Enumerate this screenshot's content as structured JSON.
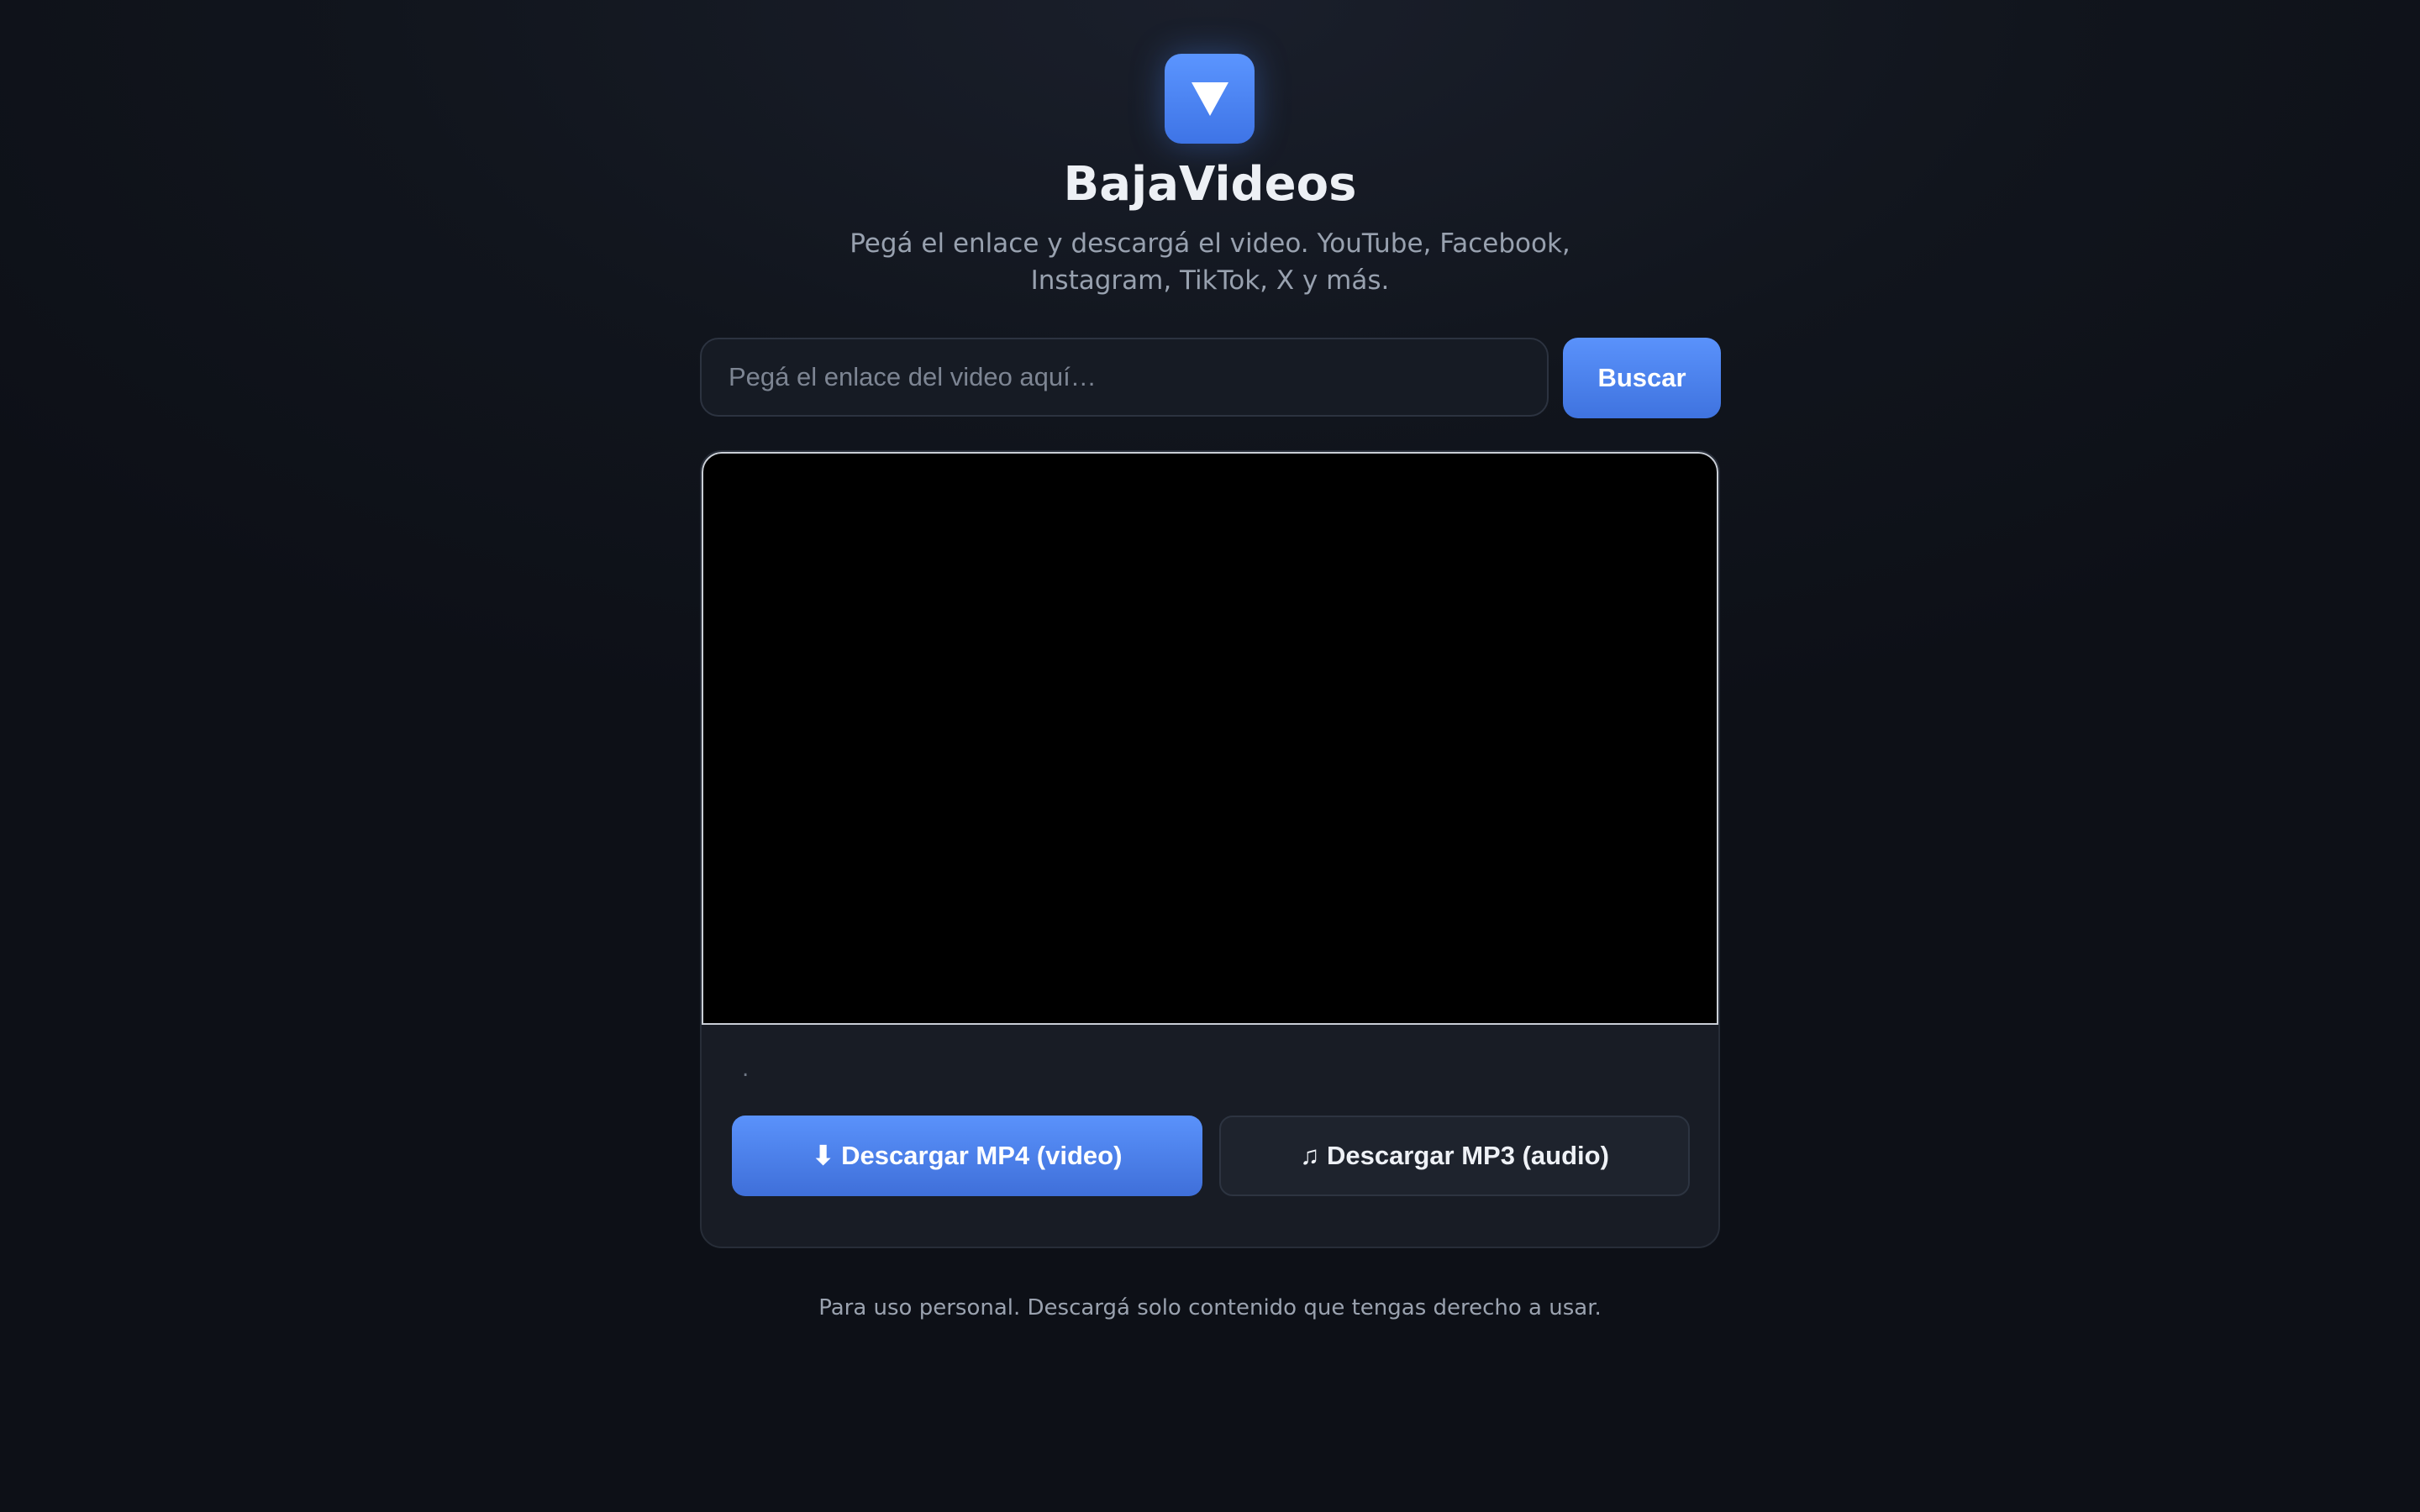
{
  "app": {
    "logo_icon": "down-triangle-icon",
    "title": "BajaVideos",
    "subtitle": "Pegá el enlace y descargá el video. YouTube, Facebook, Instagram, TikTok, X y más."
  },
  "search": {
    "placeholder": "Pegá el enlace del video aquí…",
    "value": "",
    "button_label": "Buscar"
  },
  "result": {
    "status_text": ".",
    "download_mp4_label": "⬇ Descargar MP4 (video)",
    "download_mp3_label": "♫ Descargar MP3 (audio)"
  },
  "footer": {
    "text": "Para uso personal. Descargá solo contenido que tengas derecho a usar."
  },
  "colors": {
    "accent": "#4f86f7",
    "background": "#11151d",
    "card": "#181c25"
  }
}
